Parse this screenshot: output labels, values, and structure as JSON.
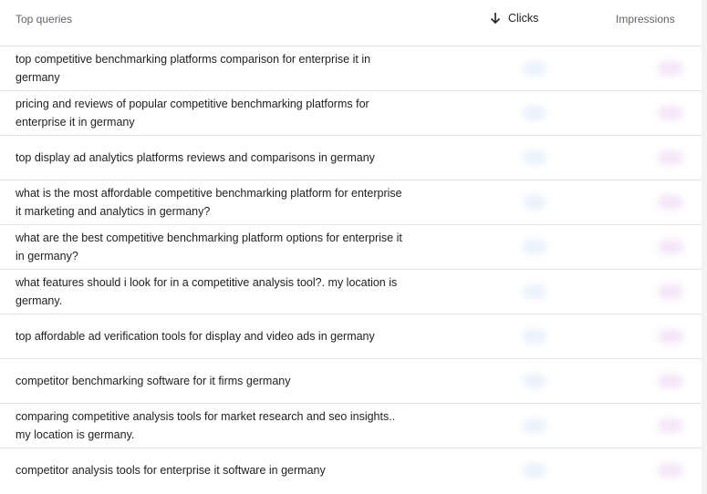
{
  "header": {
    "queries_label": "Top queries",
    "clicks_label": "Clicks",
    "impressions_label": "Impressions",
    "sort_icon": "arrow-down-icon"
  },
  "rows": [
    {
      "query_line1": "top competitive benchmarking platforms comparison for enterprise it in",
      "query_line2": "germany"
    },
    {
      "query_line1": "pricing and reviews of popular competitive benchmarking platforms for",
      "query_line2": "enterprise it in germany"
    },
    {
      "query_line1": "top display ad analytics platforms reviews and comparisons in germany",
      "query_line2": ""
    },
    {
      "query_line1": "what is the most affordable competitive benchmarking platform for enterprise",
      "query_line2": "it marketing and analytics in germany?"
    },
    {
      "query_line1": "what are the best competitive benchmarking platform options for enterprise it",
      "query_line2": "in germany?"
    },
    {
      "query_line1": "what features should i look for in a competitive analysis tool?. my location is",
      "query_line2": "germany."
    },
    {
      "query_line1": "top affordable ad verification tools for display and video ads in germany",
      "query_line2": ""
    },
    {
      "query_line1": "competitor benchmarking software for it firms germany",
      "query_line2": ""
    },
    {
      "query_line1": "comparing competitive analysis tools for market research and seo insights..",
      "query_line2": "my location is germany."
    },
    {
      "query_line1": "competitor analysis tools for enterprise it software in germany",
      "query_line2": ""
    }
  ],
  "colors": {
    "clicks_blur": "#eaf2fb",
    "impressions_blur": "#f4e6f8",
    "divider": "#e3e3e3"
  }
}
